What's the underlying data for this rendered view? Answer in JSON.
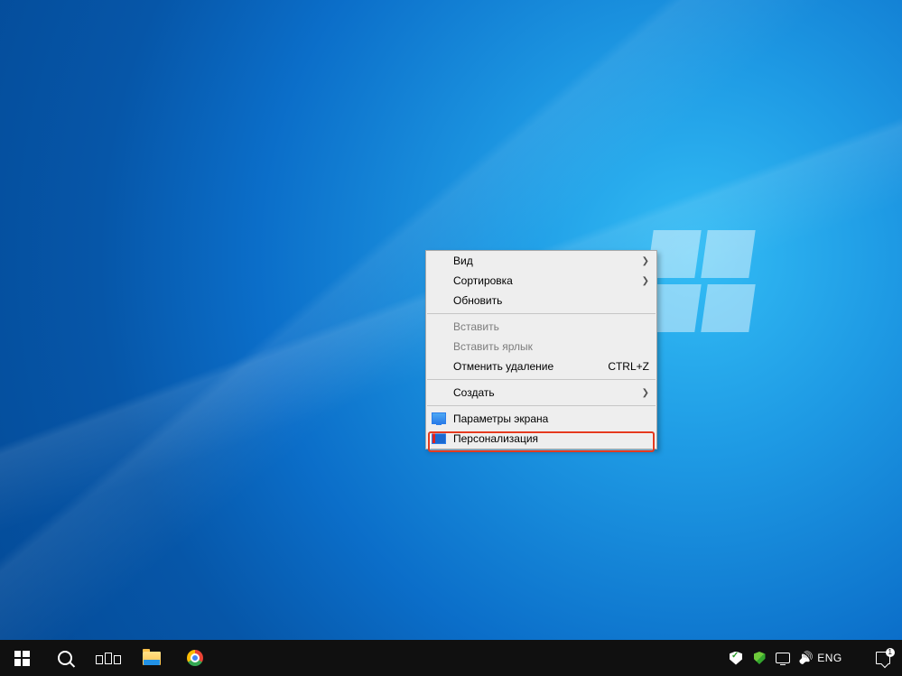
{
  "context_menu": {
    "items": [
      {
        "label": "Вид",
        "has_submenu": true
      },
      {
        "label": "Сортировка",
        "has_submenu": true
      },
      {
        "label": "Обновить"
      },
      {
        "separator": true
      },
      {
        "label": "Вставить",
        "disabled": true
      },
      {
        "label": "Вставить ярлык",
        "disabled": true
      },
      {
        "label": "Отменить удаление",
        "shortcut": "CTRL+Z"
      },
      {
        "separator": true
      },
      {
        "label": "Создать",
        "has_submenu": true
      },
      {
        "separator": true
      },
      {
        "label": "Параметры экрана",
        "icon": "display"
      },
      {
        "label": "Персонализация",
        "icon": "personalization",
        "highlighted": true
      }
    ]
  },
  "taskbar": {
    "systray": {
      "language": "ENG",
      "time": "",
      "date": "",
      "notifications_badge": "1"
    }
  }
}
